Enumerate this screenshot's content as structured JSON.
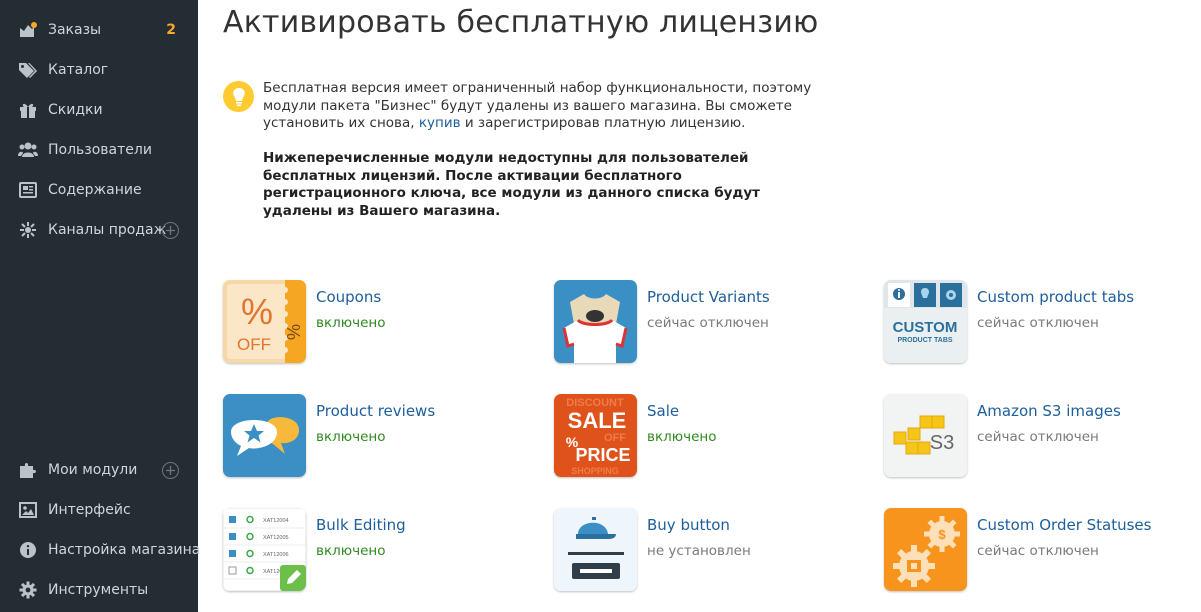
{
  "sidebar": {
    "items": [
      {
        "label": "Заказы",
        "badge": "2",
        "icon": "orders-icon"
      },
      {
        "label": "Каталог",
        "icon": "tags-icon"
      },
      {
        "label": "Скидки",
        "icon": "gift-icon"
      },
      {
        "label": "Пользователи",
        "icon": "users-icon"
      },
      {
        "label": "Содержание",
        "icon": "newspaper-icon"
      },
      {
        "label": "Каналы продаж",
        "icon": "sales-channels-icon",
        "has_add": true
      },
      {
        "label": "Мои модули",
        "icon": "puzzle-icon",
        "has_add": true
      },
      {
        "label": "Интерфейс",
        "icon": "picture-icon"
      },
      {
        "label": "Настройка магазина",
        "icon": "info-icon"
      },
      {
        "label": "Инструменты",
        "icon": "gear-icon"
      }
    ]
  },
  "page": {
    "title": "Активировать бесплатную лицензию",
    "note_before_link": "Бесплатная версия имеет ограниченный набор функциональности, поэтому модули пакета \"Бизнес\" будут удалены из вашего магазина. Вы сможете установить их снова, ",
    "note_link": "купив",
    "note_after_link": " и зарегистрировав платную лицензию.",
    "warning": "Нижеперечисленные модули недоступны для пользователей бесплатных лицензий. После активации бесплатного регистрационного ключа, все модули из данного списка будут удалены из Вашего магазина."
  },
  "modules": [
    {
      "name": "Coupons",
      "status": "включено",
      "enabled": true,
      "icon": "coupons-icon"
    },
    {
      "name": "Product Variants",
      "status": "сейчас отключен",
      "enabled": false,
      "icon": "product-variants-icon"
    },
    {
      "name": "Custom product tabs",
      "status": "сейчас отключен",
      "enabled": false,
      "icon": "custom-tabs-icon",
      "icon_text": "CUSTOM",
      "icon_subtext": "PRODUCT TABS"
    },
    {
      "name": "Product reviews",
      "status": "включено",
      "enabled": true,
      "icon": "product-reviews-icon"
    },
    {
      "name": "Sale",
      "status": "включено",
      "enabled": true,
      "icon": "sale-icon"
    },
    {
      "name": "Amazon S3 images",
      "status": "сейчас отключен",
      "enabled": false,
      "icon": "amazon-s3-icon",
      "icon_text": "S3"
    },
    {
      "name": "Bulk Editing",
      "status": "включено",
      "enabled": true,
      "icon": "bulk-editing-icon"
    },
    {
      "name": "Buy button",
      "status": "не установлен",
      "enabled": false,
      "icon": "buy-button-icon"
    },
    {
      "name": "Custom Order Statuses",
      "status": "сейчас отключен",
      "enabled": false,
      "icon": "order-statuses-icon"
    }
  ],
  "colors": {
    "sidebar_bg": "#232d33",
    "link": "#1d5e9b",
    "enabled": "#2f8a1f",
    "badge": "#ffa726",
    "note_icon": "#ffcb30"
  }
}
